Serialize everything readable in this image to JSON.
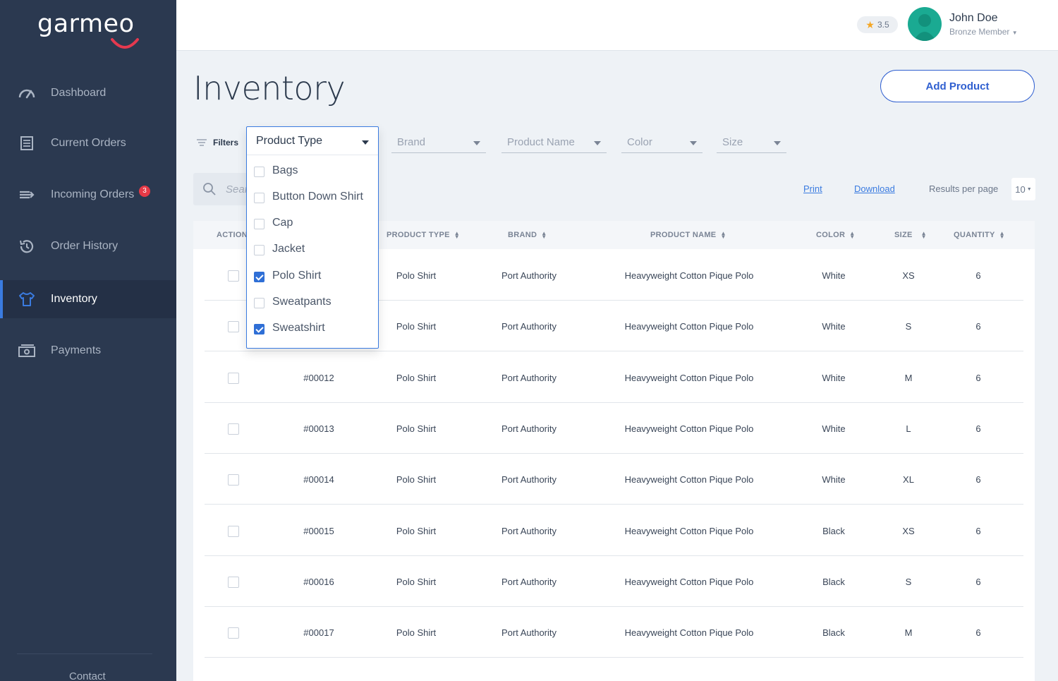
{
  "app": {
    "logo": "garmeo"
  },
  "sidebar": {
    "items": [
      {
        "label": "Dashboard",
        "icon": "speedometer-icon"
      },
      {
        "label": "Current Orders",
        "icon": "clipboard-list-icon"
      },
      {
        "label": "Incoming Orders",
        "icon": "incoming-arrow-icon",
        "badge": "3"
      },
      {
        "label": "Order History",
        "icon": "history-icon"
      },
      {
        "label": "Inventory",
        "icon": "tshirt-icon",
        "active": true
      },
      {
        "label": "Payments",
        "icon": "money-icon"
      }
    ],
    "contact": "Contact"
  },
  "header": {
    "rating": "3.5",
    "user_name": "John Doe",
    "user_level": "Bronze Member"
  },
  "page": {
    "title": "Inventory",
    "add_button": "Add Product"
  },
  "filters": {
    "label": "Filters",
    "product_type": {
      "label": "Product Type",
      "options": [
        {
          "label": "Bags",
          "checked": false
        },
        {
          "label": "Button Down Shirt",
          "checked": false
        },
        {
          "label": "Cap",
          "checked": false
        },
        {
          "label": "Jacket",
          "checked": false
        },
        {
          "label": "Polo Shirt",
          "checked": true
        },
        {
          "label": "Sweatpants",
          "checked": false
        },
        {
          "label": "Sweatshirt",
          "checked": true
        }
      ]
    },
    "brand": "Brand",
    "product_name": "Product Name",
    "color": "Color",
    "size": "Size"
  },
  "toolbar": {
    "search_placeholder": "Search",
    "print": "Print",
    "download": "Download",
    "results_per_page_label": "Results per page",
    "results_per_page_value": "10"
  },
  "table": {
    "columns": [
      "ACTION",
      "PRODUCT TYPE",
      "BRAND",
      "PRODUCT NAME",
      "COLOR",
      "SIZE",
      "QUANTITY"
    ],
    "rows": [
      {
        "id": "",
        "type": "Polo Shirt",
        "brand": "Port Authority",
        "name": "Heavyweight Cotton Pique Polo",
        "color": "White",
        "size": "XS",
        "qty": "6"
      },
      {
        "id": "",
        "type": "Polo Shirt",
        "brand": "Port Authority",
        "name": "Heavyweight Cotton Pique Polo",
        "color": "White",
        "size": "S",
        "qty": "6"
      },
      {
        "id": "#00012",
        "type": "Polo Shirt",
        "brand": "Port Authority",
        "name": "Heavyweight Cotton Pique Polo",
        "color": "White",
        "size": "M",
        "qty": "6"
      },
      {
        "id": "#00013",
        "type": "Polo Shirt",
        "brand": "Port Authority",
        "name": "Heavyweight Cotton Pique Polo",
        "color": "White",
        "size": "L",
        "qty": "6"
      },
      {
        "id": "#00014",
        "type": "Polo Shirt",
        "brand": "Port Authority",
        "name": "Heavyweight Cotton Pique Polo",
        "color": "White",
        "size": "XL",
        "qty": "6"
      },
      {
        "id": "#00015",
        "type": "Polo Shirt",
        "brand": "Port Authority",
        "name": "Heavyweight Cotton Pique Polo",
        "color": "Black",
        "size": "XS",
        "qty": "6"
      },
      {
        "id": "#00016",
        "type": "Polo Shirt",
        "brand": "Port Authority",
        "name": "Heavyweight Cotton Pique Polo",
        "color": "Black",
        "size": "S",
        "qty": "6"
      },
      {
        "id": "#00017",
        "type": "Polo Shirt",
        "brand": "Port Authority",
        "name": "Heavyweight Cotton Pique Polo",
        "color": "Black",
        "size": "M",
        "qty": "6"
      }
    ]
  },
  "colors": {
    "sidebar": "#2b3950",
    "accent": "#2f5fd0",
    "badge": "#e53946",
    "avatar": "#1aaa92",
    "star": "#f5a623"
  }
}
